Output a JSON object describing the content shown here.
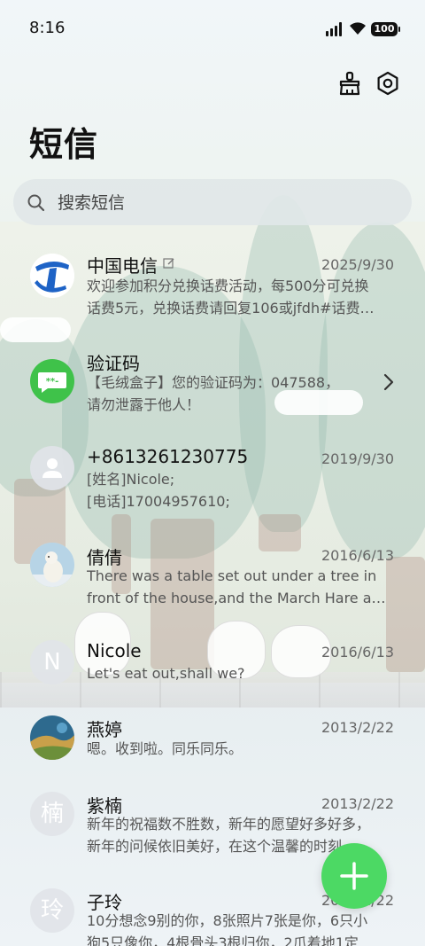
{
  "status_bar": {
    "time": "8:16",
    "battery": "100"
  },
  "header": {
    "title": "短信"
  },
  "search": {
    "placeholder": "搜索短信"
  },
  "conversations": [
    {
      "name": "中国电信",
      "date": "2025/9/30",
      "line1": "欢迎参加积分兑换话费活动，每500分可兑换",
      "line2": "话费5元，兑换话费请回复106或jfdh#话费…",
      "avatar": "china-telecom-logo"
    },
    {
      "name": "验证码",
      "date": "",
      "line1": "【毛绒盒子】您的验证码为：047588，",
      "line2": "请勿泄露于他人！",
      "avatar": "message-bubble"
    },
    {
      "name": "+8613261230775",
      "date": "2019/9/30",
      "line1": "[姓名]Nicole;",
      "line2": "[电话]17004957610;",
      "avatar": "default-person"
    },
    {
      "name": "倩倩",
      "date": "2016/6/13",
      "line1": "There was a table set out under a tree in",
      "line2": "front of the house,and the March Hare an…",
      "avatar": "polar-bear-photo"
    },
    {
      "name": "Nicole",
      "date": "2016/6/13",
      "line1": "Let's eat out,shall we?",
      "line2": "",
      "avatar": "N"
    },
    {
      "name": "燕婷",
      "date": "2013/2/22",
      "line1": "嗯。收到啦。同乐同乐。",
      "line2": "",
      "avatar": "landscape-photo"
    },
    {
      "name": "紫楠",
      "date": "2013/2/22",
      "line1": "新年的祝福数不胜数，新年的愿望好多好多，",
      "line2": "新年的问候依旧美好，在这个温馨的时刻…",
      "avatar": "楠"
    },
    {
      "name": "子玲",
      "date": "2013/2/22",
      "line1": "10分想念9别的你，8张照片7张是你，6只小",
      "line2": "狗5只像你，4根骨头3根归你，2爪着地1定",
      "avatar": "玲"
    }
  ],
  "colors": {
    "fab": "#4cd964",
    "verification_avatar": "#3fc24a",
    "telecom_blue": "#1e63c6"
  },
  "icons": {
    "top_left": "broom-icon",
    "top_right": "settings-icon",
    "fab": "plus-icon",
    "row_arrow": "chevron-right-icon"
  }
}
